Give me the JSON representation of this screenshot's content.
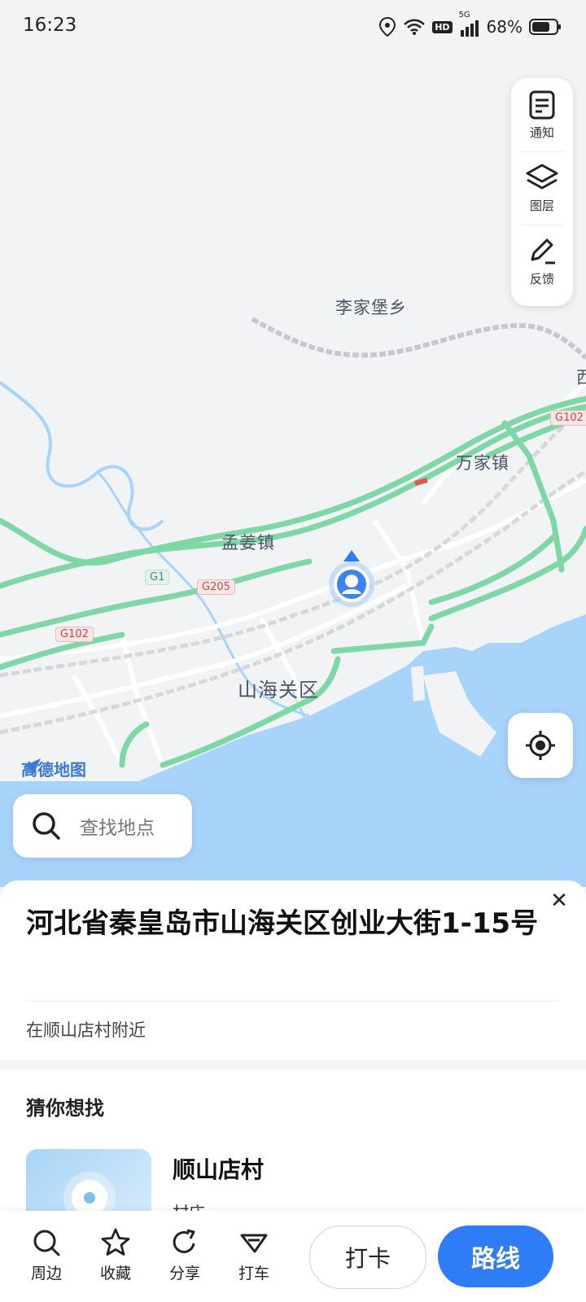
{
  "status_bar": {
    "time": "16:23",
    "network": "5G",
    "hd": "HD",
    "battery": "68%"
  },
  "map": {
    "labels": {
      "lijiabao": "李家堡乡",
      "wanjia": "万家镇",
      "mengjiang": "孟姜镇",
      "shanhaiguan": "山海关区",
      "edge": "西"
    },
    "shields": {
      "g1": "G1",
      "g205": "G205",
      "g102_left": "G102",
      "g102_right": "G102"
    },
    "brand": "高德地图"
  },
  "tools": {
    "notice": "通知",
    "layers": "图层",
    "feedback": "反馈"
  },
  "search": {
    "placeholder": "查找地点"
  },
  "sheet": {
    "address": "河北省秦皇岛市山海关区创业大街1-15号",
    "nearby": "在顺山店村附近",
    "guess_title": "猜你想找",
    "poi": {
      "name": "顺山店村",
      "type": "村庄"
    }
  },
  "bottom_nav": {
    "nearby": "周边",
    "favorite": "收藏",
    "share": "分享",
    "taxi": "打车",
    "checkin": "打卡",
    "route": "路线"
  },
  "colors": {
    "road": "#7fd7a6",
    "water": "#a8d3fb",
    "accent": "#2e7cf6"
  }
}
